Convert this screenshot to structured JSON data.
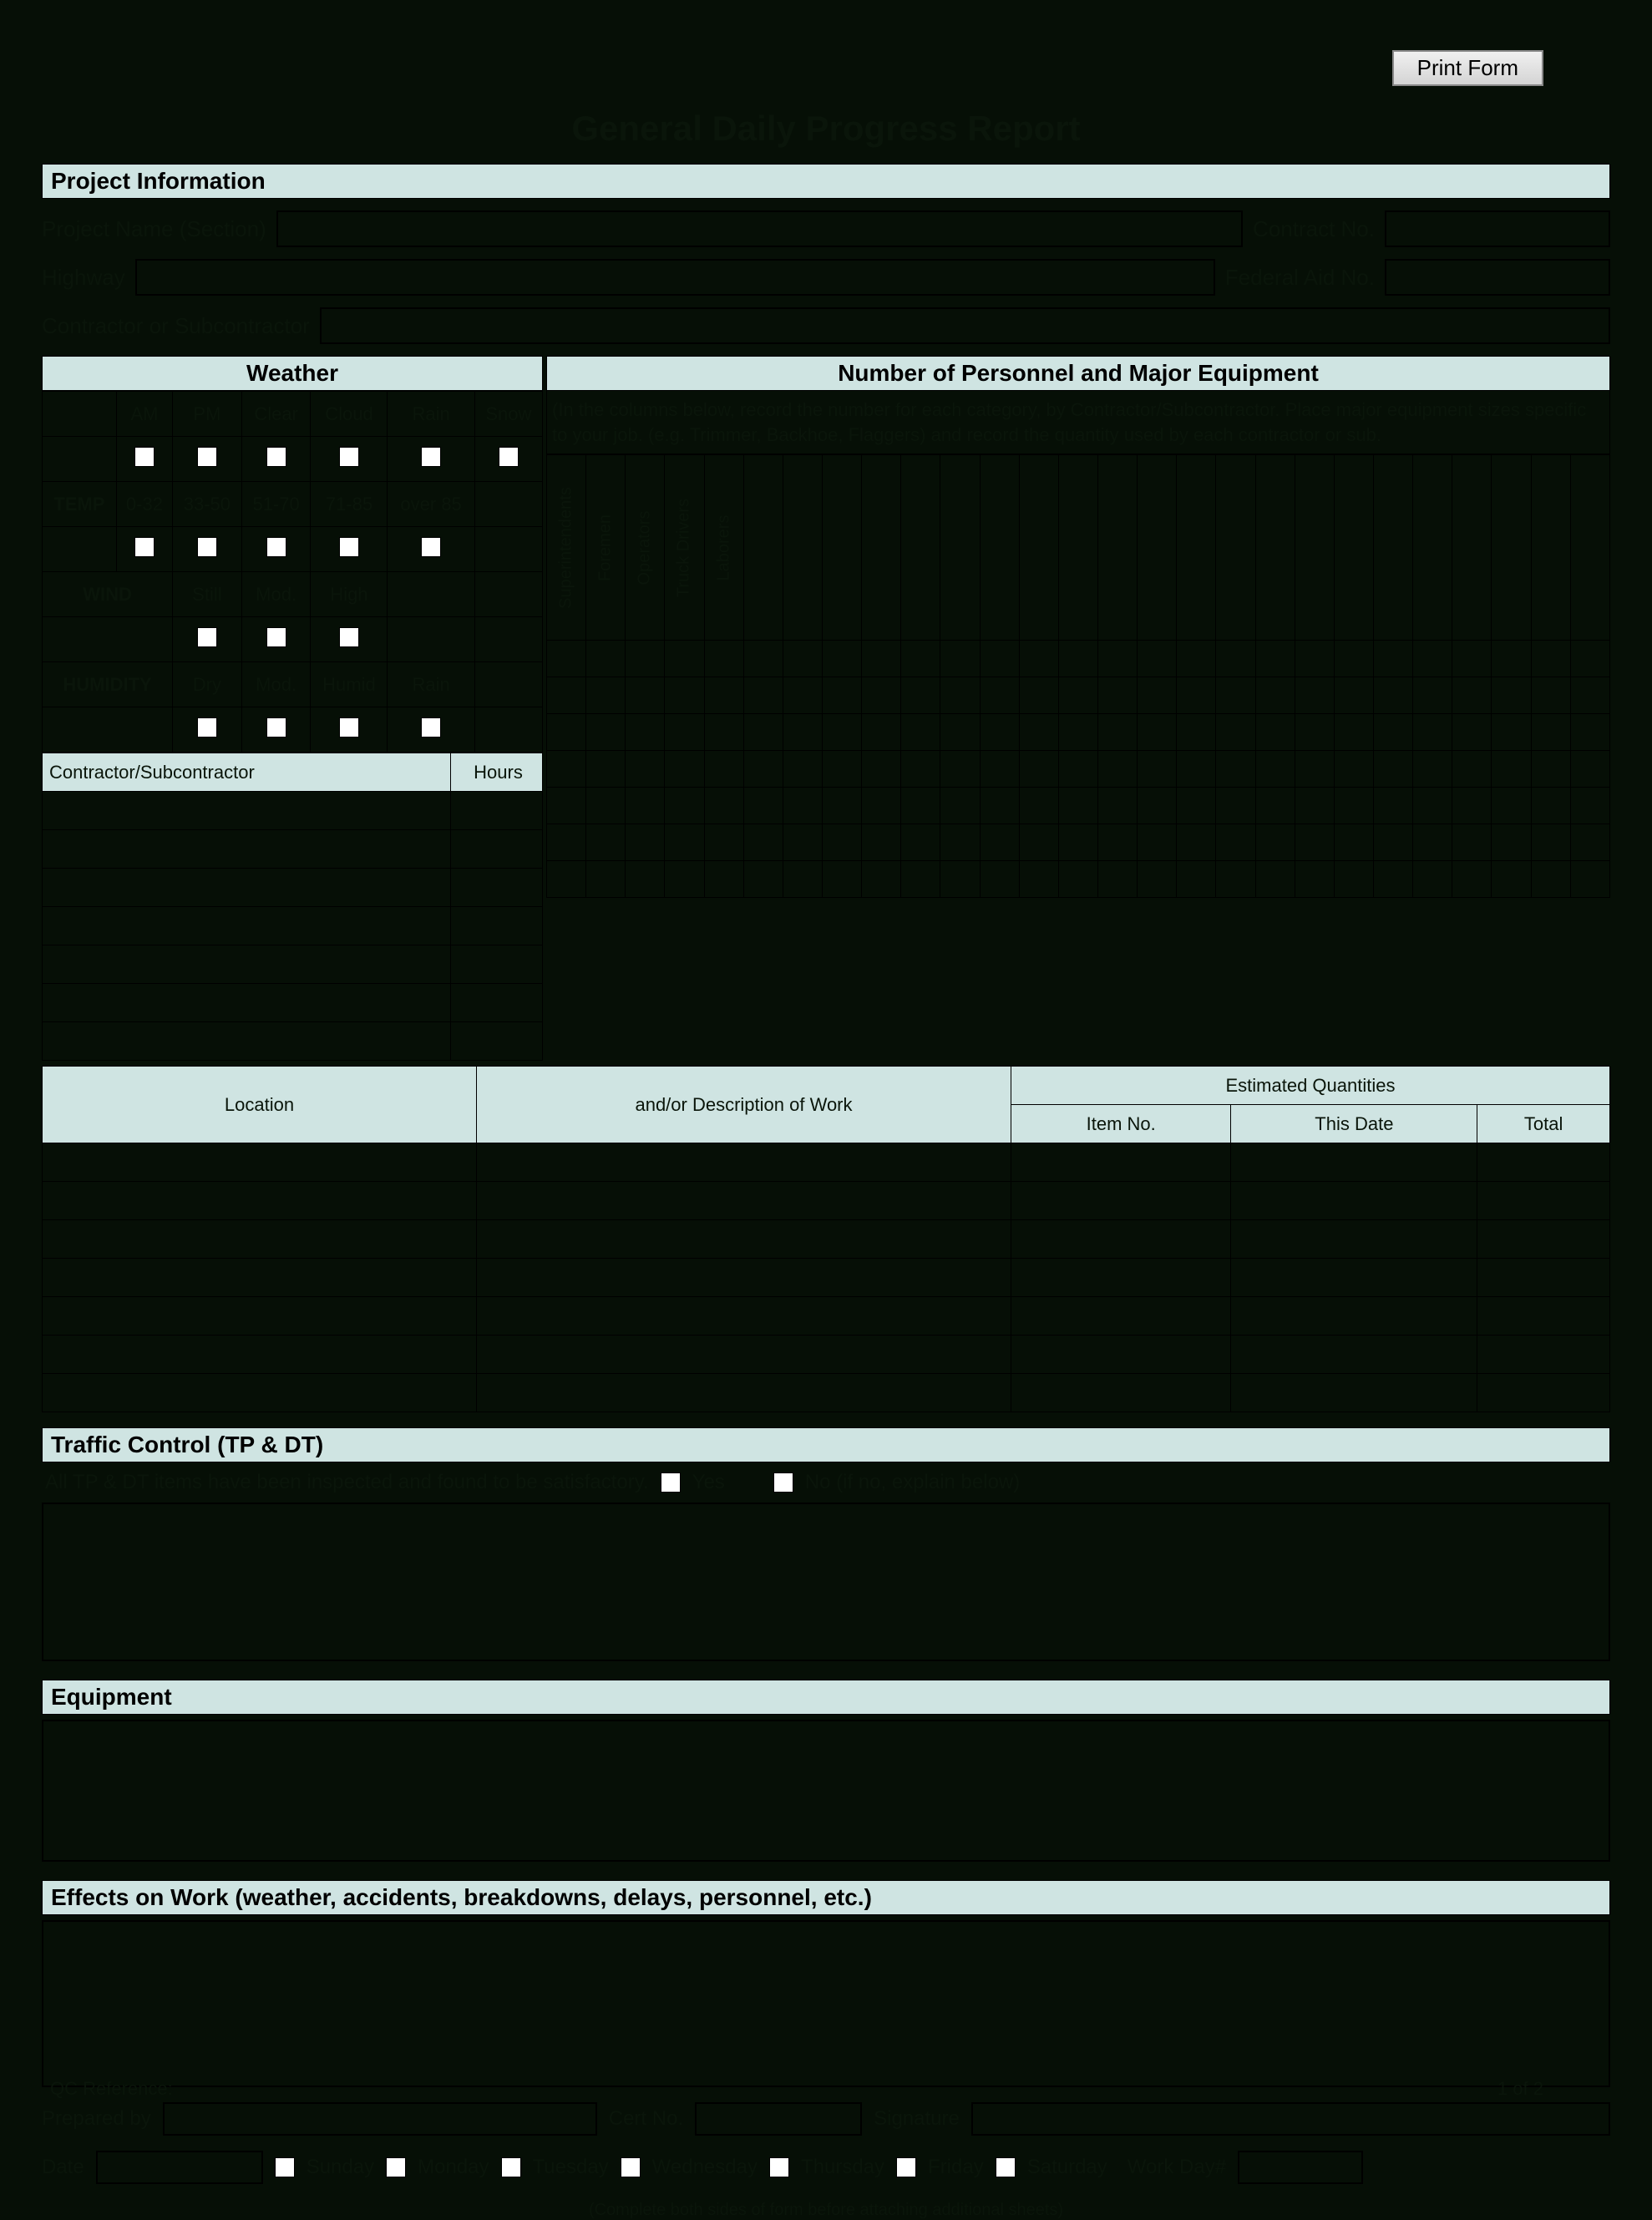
{
  "buttons": {
    "print": "Print Form"
  },
  "title": "General Daily Progress Report",
  "sections": {
    "project_info": "Project Information",
    "weather": "Weather",
    "personnel": "Number of Personnel and Major Equipment",
    "traffic": "Traffic Control (TP & DT)",
    "equipment": "Equipment",
    "effects": "Effects on Work (weather, accidents, breakdowns, delays, personnel, etc.)"
  },
  "project": {
    "name_label": "Project Name (Section)",
    "contract_label": "Contract No.",
    "highway_label": "Highway",
    "federal_label": "Federal Aid No.",
    "contractor_label": "Contractor or Subcontractor"
  },
  "weather": {
    "col_headers": [
      "",
      "AM",
      "PM",
      "Clear",
      "Cloud",
      "Rain",
      "Snow"
    ],
    "temp_row": "TEMP",
    "temp_cols": [
      "0-32",
      "33-50",
      "51-70",
      "71-85",
      "over 85"
    ],
    "wind": "WIND",
    "wind_cols": [
      "Still",
      "Mod.",
      "High"
    ],
    "humidity": "HUMIDITY",
    "humidity_cols": [
      "Dry",
      "Mod.",
      "Humid",
      "Rain"
    ],
    "cs_header": "Contractor/Subcontractor",
    "hours_header": "Hours"
  },
  "personnel": {
    "note": "(In the columns below, record the number for each category, by Contractor/Subcontractor. Place major equipment sizes specific to your job. (e.g. Trimmer, Backhoe, Flaggers) and record the quantity used by each contractor or sub.",
    "vert_labels": [
      "Superintendents",
      "Foremen",
      "Operators",
      "Truck Drivers",
      "Laborers"
    ]
  },
  "loc": {
    "location": "Location",
    "desc": "and/or Description of Work",
    "est": "Estimated Quantities",
    "item": "Item No.",
    "date": "This Date",
    "total": "Total"
  },
  "traffic": {
    "line": "All TP & DT items have been inspected and found to be satisfactory.",
    "yes": "Yes",
    "no": "No (if no, explain below)"
  },
  "footer": {
    "prepared": "Prepared by",
    "cert": "Cert No.",
    "sign": "Signature",
    "date": "Date",
    "days": [
      "Sunday",
      "Monday",
      "Tuesday",
      "Wednesday",
      "Thursday",
      "Friday",
      "Saturday"
    ],
    "workday": "Work Day#",
    "note": "(Complete both sides of form before attaching additional sheets)",
    "qc": "QC Reference:",
    "page": "1 of 2"
  }
}
